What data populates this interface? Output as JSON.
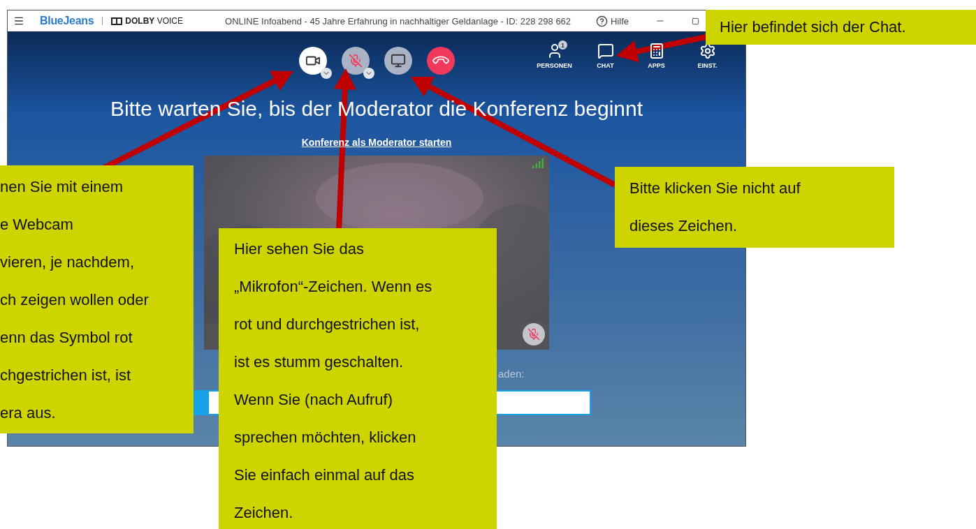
{
  "window": {
    "brand": "BlueJeans",
    "partner": "**DOLBY** VOICE",
    "title": "ONLINE Infoabend - 45 Jahre Erfahrung in nachhaltiger Geldanlage  - ID: 228 298 662",
    "help": "Hilfe"
  },
  "call_controls": {
    "camera_on": true,
    "mic_muted": true
  },
  "nav": [
    {
      "kind": "people",
      "label": "PERSONEN",
      "badge": "1"
    },
    {
      "kind": "chat",
      "label": "CHAT"
    },
    {
      "kind": "apps",
      "label": "APPS"
    },
    {
      "kind": "settings",
      "label": "EINST."
    }
  ],
  "heading": "Bitte warten Sie, bis der Moderator die Konferenz beginnt",
  "moderator_link": "Konferenz als Moderator starten",
  "video_tile": {
    "kind": "picture",
    "muted": true
  },
  "invite_label": "aden:",
  "callouts": [
    {
      "lines": [
        "Hier befindet sich der Chat."
      ]
    },
    {
      "lines": [
        "nen Sie mit einem",
        "e Webcam",
        "vieren, je nachdem,",
        "ch zeigen wollen oder",
        "enn das Symbol rot",
        "chgestrichen ist, ist",
        "era aus."
      ]
    },
    {
      "lines": [
        "Bitte klicken Sie nicht auf",
        "dieses Zeichen."
      ]
    },
    {
      "lines": [
        "Hier sehen Sie das",
        "„Mikrofon“-Zeichen. Wenn es",
        "rot und durchgestrichen ist,",
        "ist es stumm geschalten.",
        "Wenn Sie (nach Aufruf)",
        "sprechen möchten, klicken",
        "Sie einfach einmal auf das",
        "Zeichen."
      ]
    }
  ]
}
